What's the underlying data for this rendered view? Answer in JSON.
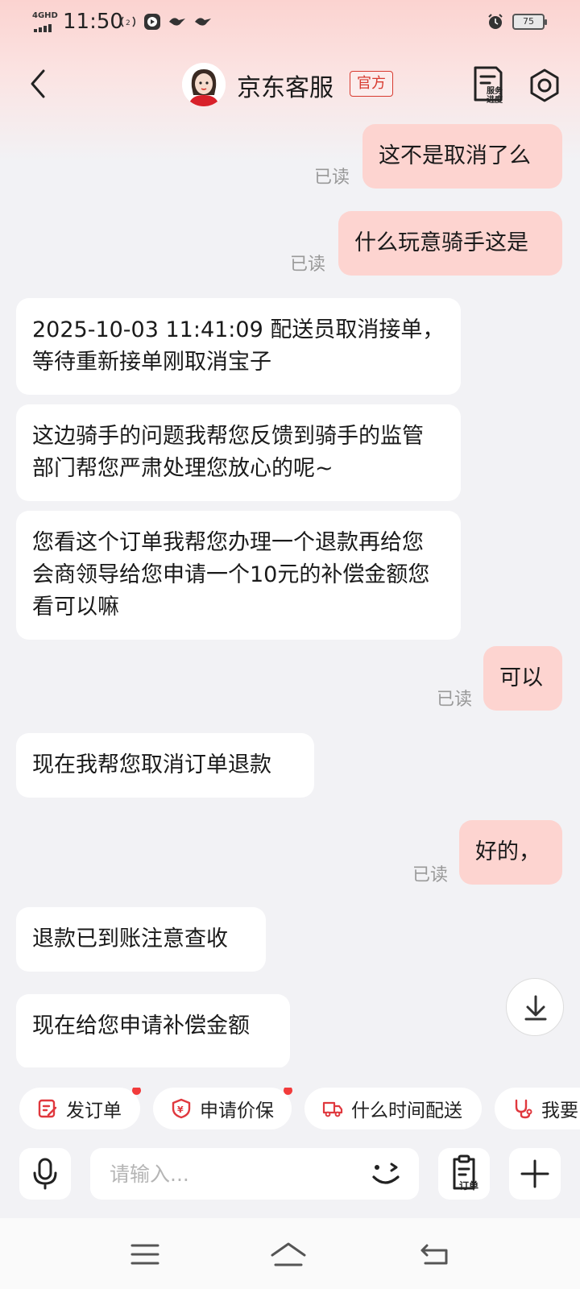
{
  "status_bar": {
    "network": "4GHD",
    "time": "11:50",
    "battery": "75"
  },
  "header": {
    "title": "京东客服",
    "badge": "官方",
    "service_progress": "服务进度"
  },
  "messages": [
    {
      "from": "me",
      "text": "这不是取消了么",
      "status": "已读"
    },
    {
      "from": "me",
      "text": "什么玩意骑手这是",
      "status": "已读"
    },
    {
      "from": "them",
      "text": "2025-10-03 11:41:09   配送员取消接单，等待重新接单刚取消宝子"
    },
    {
      "from": "them",
      "text": "这边骑手的问题我帮您反馈到骑手的监管部门帮您严肃处理您放心的呢~"
    },
    {
      "from": "them",
      "text": "您看这个订单我帮您办理一个退款再给您会商领导给您申请一个10元的补偿金额您看可以嘛"
    },
    {
      "from": "me",
      "text": "可以",
      "status": "已读"
    },
    {
      "from": "them",
      "text": "现在我帮您取消订单退款"
    },
    {
      "from": "me",
      "text": "好的，",
      "status": "已读"
    },
    {
      "from": "them",
      "text": "退款已到账注意查收"
    },
    {
      "from": "them",
      "text": "现在给您申请补偿金额"
    }
  ],
  "quick_actions": [
    {
      "label": "发订单",
      "icon": "edit-order-icon",
      "dot": true
    },
    {
      "label": "申请价保",
      "icon": "price-protect-icon",
      "dot": true
    },
    {
      "label": "什么时间配送",
      "icon": "delivery-truck-icon",
      "dot": false
    },
    {
      "label": "我要",
      "icon": "stethoscope-icon",
      "dot": false
    }
  ],
  "input": {
    "placeholder": "请输入...",
    "value": "",
    "order_label": "订单"
  },
  "colors": {
    "accent": "#d83b30",
    "my_bubble": "#fdd4d0",
    "their_bubble": "#ffffff",
    "background": "#f2f2f5",
    "badge_dot": "#f23b3b"
  }
}
